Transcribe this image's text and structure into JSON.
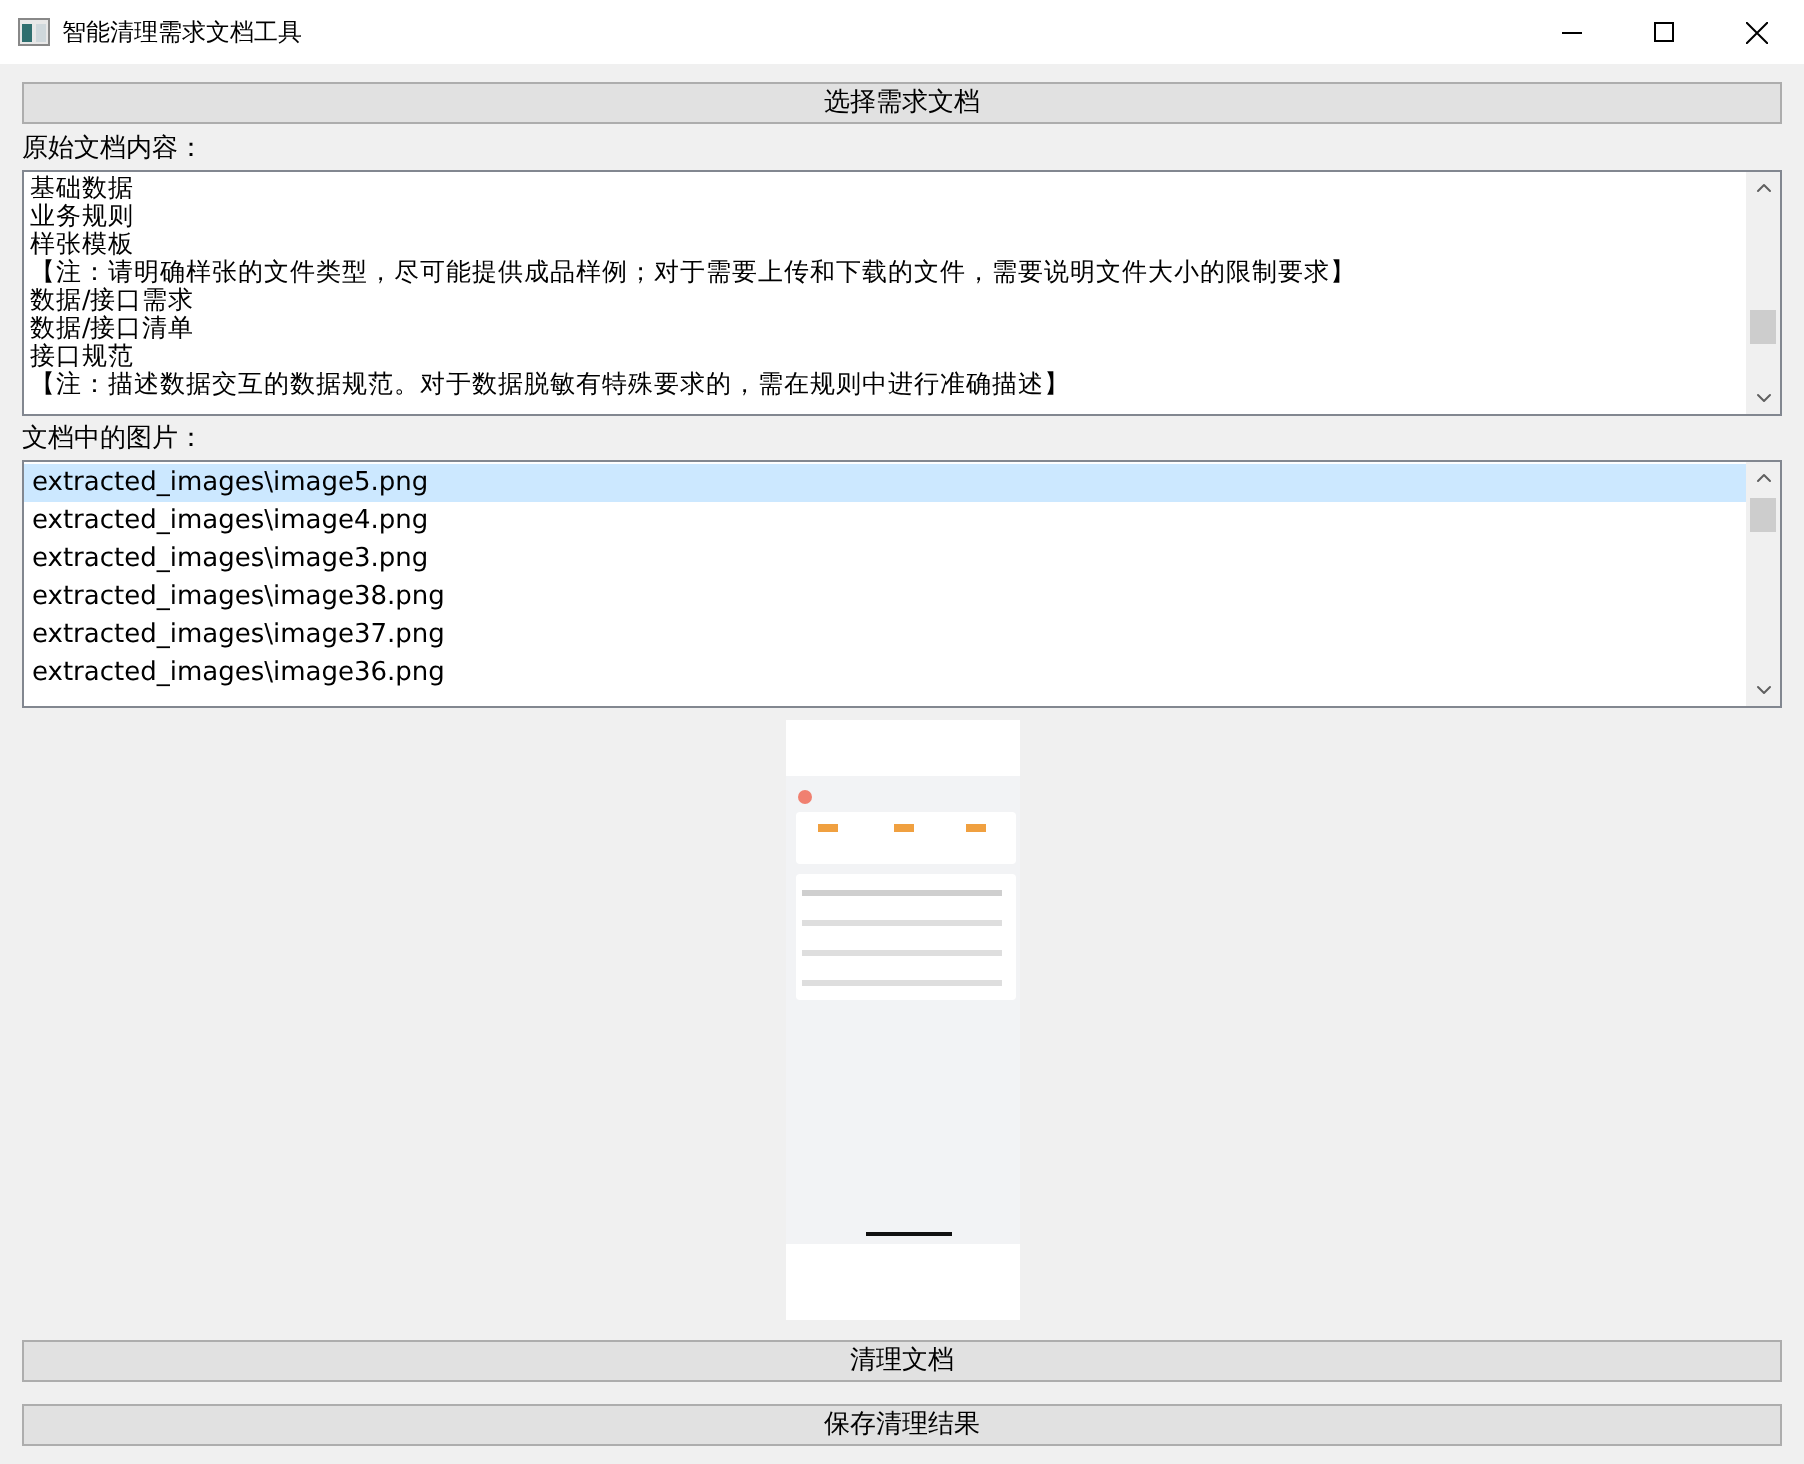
{
  "window": {
    "title": "智能清理需求文档工具"
  },
  "select_button": "选择需求文档",
  "content_label": "原始文档内容：",
  "content_lines": [
    "基础数据",
    "业务规则",
    "样张模板",
    "【注：请明确样张的文件类型，尽可能提供成品样例；对于需要上传和下载的文件，需要说明文件大小的限制要求】",
    "数据/接口需求",
    "数据/接口清单",
    "接口规范",
    "【注：描述数据交互的数据规范。对于数据脱敏有特殊要求的，需在规则中进行准确描述】"
  ],
  "images_label": "文档中的图片：",
  "images": [
    {
      "name": "extracted_images\\image5.png",
      "selected": true
    },
    {
      "name": "extracted_images\\image4.png",
      "selected": false
    },
    {
      "name": "extracted_images\\image3.png",
      "selected": false
    },
    {
      "name": "extracted_images\\image38.png",
      "selected": false
    },
    {
      "name": "extracted_images\\image37.png",
      "selected": false
    },
    {
      "name": "extracted_images\\image36.png",
      "selected": false
    }
  ],
  "clean_button": "清理文档",
  "save_button": "保存清理结果"
}
